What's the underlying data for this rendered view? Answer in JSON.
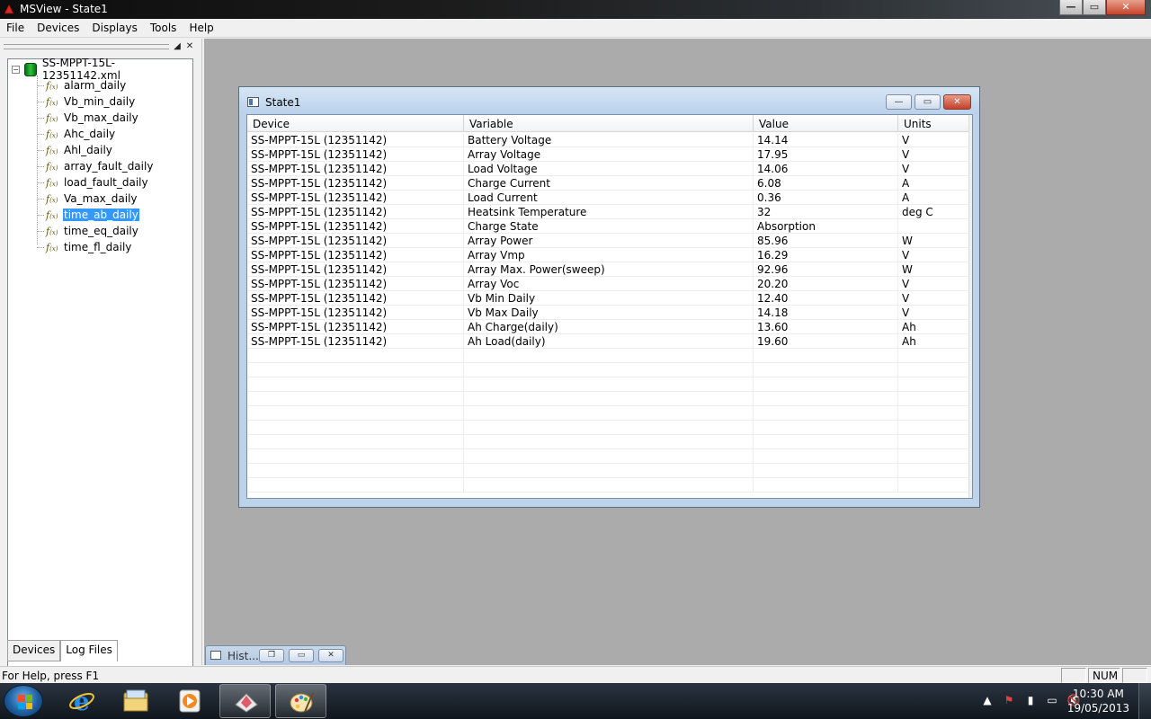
{
  "window": {
    "title": "MSView - State1",
    "min_glyph": "—",
    "max_glyph": "▭",
    "close_glyph": "✕"
  },
  "menu": [
    "File",
    "Devices",
    "Displays",
    "Tools",
    "Help"
  ],
  "left_panel": {
    "pin_glyph": "◢",
    "close_glyph": "✕",
    "tree": {
      "expander": "−",
      "root": "SS-MPPT-15L-12351142.xml",
      "fx_glyph": "f",
      "fx_sub": "(x)",
      "items": [
        {
          "label": "alarm_daily",
          "selected": false
        },
        {
          "label": "Vb_min_daily",
          "selected": false
        },
        {
          "label": "Vb_max_daily",
          "selected": false
        },
        {
          "label": "Ahc_daily",
          "selected": false
        },
        {
          "label": "Ahl_daily",
          "selected": false
        },
        {
          "label": "array_fault_daily",
          "selected": false
        },
        {
          "label": "load_fault_daily",
          "selected": false
        },
        {
          "label": "Va_max_daily",
          "selected": false
        },
        {
          "label": "time_ab_daily",
          "selected": true
        },
        {
          "label": "time_eq_daily",
          "selected": false
        },
        {
          "label": "time_fl_daily",
          "selected": false
        }
      ]
    },
    "tabs": [
      "Devices",
      "Log Files"
    ],
    "active_tab": "Log Files"
  },
  "child_window": {
    "title": "State1",
    "min_glyph": "—",
    "max_glyph": "▭",
    "close_glyph": "✕",
    "columns": [
      "Device",
      "Variable",
      "Value",
      "Units"
    ],
    "rows": [
      [
        "SS-MPPT-15L (12351142)",
        "Battery Voltage",
        "14.14",
        "V"
      ],
      [
        "SS-MPPT-15L (12351142)",
        "Array Voltage",
        "17.95",
        "V"
      ],
      [
        "SS-MPPT-15L (12351142)",
        "Load Voltage",
        "14.06",
        "V"
      ],
      [
        "SS-MPPT-15L (12351142)",
        "Charge Current",
        "6.08",
        "A"
      ],
      [
        "SS-MPPT-15L (12351142)",
        "Load Current",
        "0.36",
        "A"
      ],
      [
        "SS-MPPT-15L (12351142)",
        "Heatsink Temperature",
        "32",
        "deg C"
      ],
      [
        "SS-MPPT-15L (12351142)",
        "Charge State",
        "Absorption",
        ""
      ],
      [
        "SS-MPPT-15L (12351142)",
        "Array Power",
        "85.96",
        "W"
      ],
      [
        "SS-MPPT-15L (12351142)",
        "Array Vmp",
        "16.29",
        "V"
      ],
      [
        "SS-MPPT-15L (12351142)",
        "Array Max. Power(sweep)",
        "92.96",
        "W"
      ],
      [
        "SS-MPPT-15L (12351142)",
        "Array Voc",
        "20.20",
        "V"
      ],
      [
        "SS-MPPT-15L (12351142)",
        "Vb Min Daily",
        "12.40",
        "V"
      ],
      [
        "SS-MPPT-15L (12351142)",
        "Vb Max Daily",
        "14.18",
        "V"
      ],
      [
        "SS-MPPT-15L (12351142)",
        "Ah Charge(daily)",
        "13.60",
        "Ah"
      ],
      [
        "SS-MPPT-15L (12351142)",
        "Ah Load(daily)",
        "19.60",
        "Ah"
      ]
    ],
    "empty_rows": 10
  },
  "minimized_child": {
    "title": "Hist...",
    "restore_glyph": "❐",
    "max_glyph": "▭",
    "close_glyph": "✕"
  },
  "status_bar": {
    "text": "For Help, press F1",
    "panes": [
      "",
      "NUM",
      ""
    ]
  },
  "taskbar": {
    "apps": [
      {
        "name": "internet-explorer",
        "open": false,
        "glyph": "e",
        "color": "#1e90ff"
      },
      {
        "name": "file-explorer",
        "open": false,
        "glyph": "",
        "color": "#e8c45a"
      },
      {
        "name": "media-player",
        "open": false,
        "glyph": "▶",
        "color": "#f08a24"
      },
      {
        "name": "msview",
        "open": true,
        "glyph": "◆",
        "color": "#e05a6a"
      },
      {
        "name": "paint",
        "open": true,
        "glyph": "✎",
        "color": "#e8c45a"
      }
    ],
    "tray_icons": [
      "▲",
      "⚑",
      "▮",
      "▭",
      "🔇"
    ],
    "time": "10:30 AM",
    "date": "19/05/2013"
  },
  "colors": {
    "selection": "#3399ff",
    "mdi_background": "#ababab",
    "child_frame": "#bcd3ea"
  }
}
